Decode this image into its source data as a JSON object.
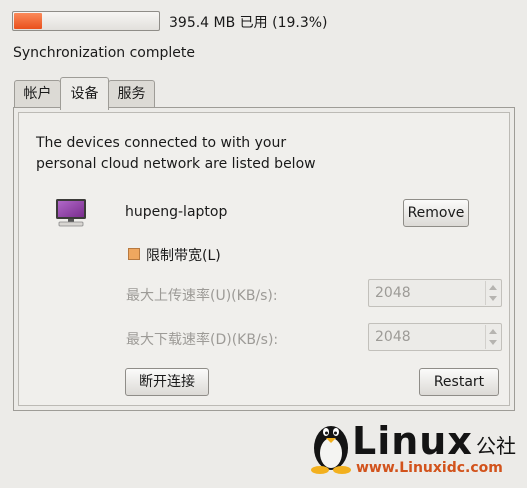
{
  "quota": {
    "used_text": "395.4 MB 已用 (19.3%)",
    "used_fraction": 0.193,
    "fill_color": "#e9501c"
  },
  "status": {
    "text": "Synchronization complete"
  },
  "tabs": [
    {
      "label": "帐户",
      "active": false
    },
    {
      "label": "设备",
      "active": true
    },
    {
      "label": "服务",
      "active": false
    }
  ],
  "devices_panel": {
    "description_line1": "The devices connected to with your",
    "description_line2": "personal cloud network are listed below",
    "device": {
      "name": "hupeng-laptop",
      "icon": "monitor-icon",
      "remove_label": "Remove"
    },
    "limit_bandwidth": {
      "label": "限制带宽(L)",
      "checked": true
    },
    "max_upload": {
      "label": "最大上传速率(U)(KB/s):",
      "value": "2048"
    },
    "max_download": {
      "label": "最大下载速率(D)(KB/s):",
      "value": "2048"
    },
    "disconnect_label": "断开连接",
    "restart_label": "Restart"
  },
  "watermark": {
    "brand": "Linux",
    "suffix": "公社",
    "url": "www.Linuxidc.com"
  }
}
